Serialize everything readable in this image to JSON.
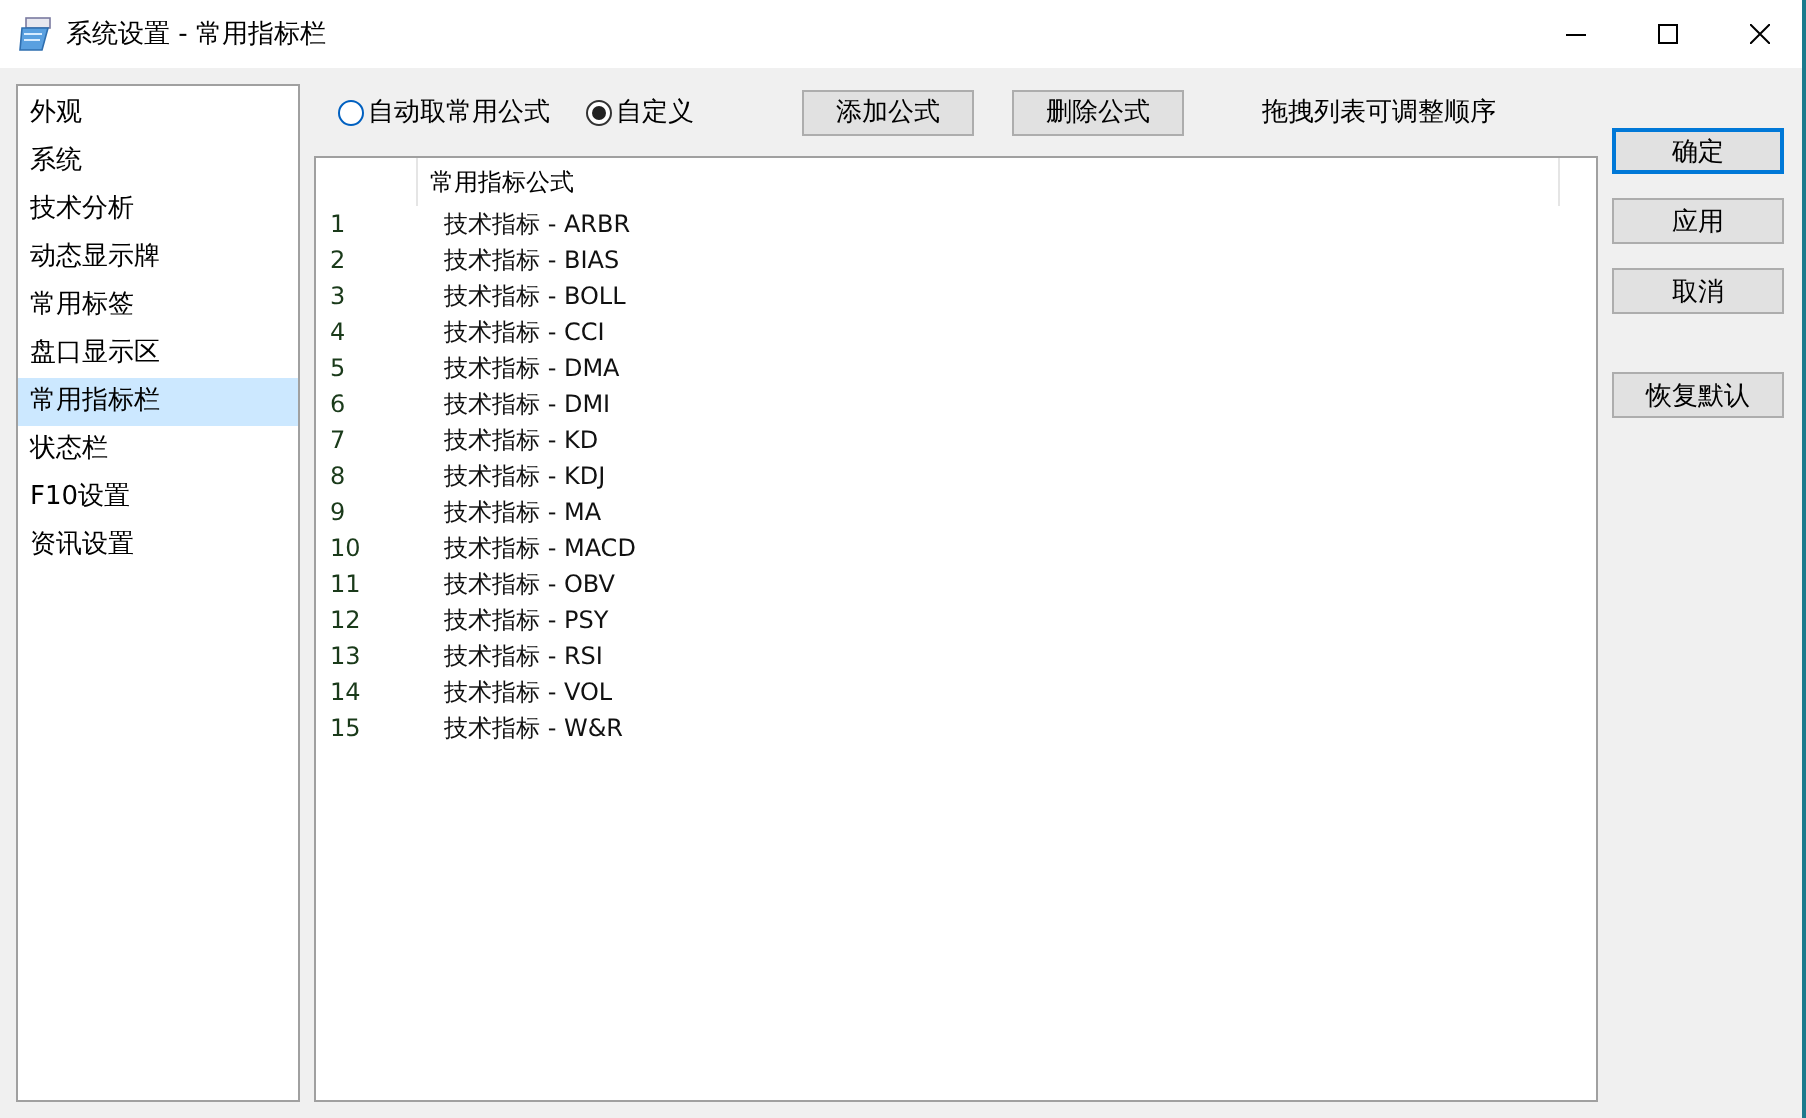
{
  "window": {
    "title": "系统设置 - 常用指标栏"
  },
  "sidebar": {
    "items": [
      {
        "label": "外观",
        "selected": false
      },
      {
        "label": "系统",
        "selected": false
      },
      {
        "label": "技术分析",
        "selected": false
      },
      {
        "label": "动态显示牌",
        "selected": false
      },
      {
        "label": "常用标签",
        "selected": false
      },
      {
        "label": "盘口显示区",
        "selected": false
      },
      {
        "label": "常用指标栏",
        "selected": true
      },
      {
        "label": "状态栏",
        "selected": false
      },
      {
        "label": "F10设置",
        "selected": false
      },
      {
        "label": "资讯设置",
        "selected": false
      }
    ]
  },
  "mode_options": [
    {
      "label": "自动取常用公式",
      "selected": false
    },
    {
      "label": "自定义",
      "selected": true
    }
  ],
  "toolbar_buttons": [
    "添加公式",
    "删除公式"
  ],
  "hint": "拖拽列表可调整顺序",
  "table": {
    "columns": [
      "常用指标公式"
    ],
    "rows": [
      {
        "index": "1",
        "formula": "技术指标 - ARBR"
      },
      {
        "index": "2",
        "formula": "技术指标 - BIAS"
      },
      {
        "index": "3",
        "formula": "技术指标 - BOLL"
      },
      {
        "index": "4",
        "formula": "技术指标 - CCI"
      },
      {
        "index": "5",
        "formula": "技术指标 - DMA"
      },
      {
        "index": "6",
        "formula": "技术指标 - DMI"
      },
      {
        "index": "7",
        "formula": "技术指标 - KD"
      },
      {
        "index": "8",
        "formula": "技术指标 - KDJ"
      },
      {
        "index": "9",
        "formula": "技术指标 - MA"
      },
      {
        "index": "10",
        "formula": "技术指标 - MACD"
      },
      {
        "index": "11",
        "formula": "技术指标 - OBV"
      },
      {
        "index": "12",
        "formula": "技术指标 - PSY"
      },
      {
        "index": "13",
        "formula": "技术指标 - RSI"
      },
      {
        "index": "14",
        "formula": "技术指标 - VOL"
      },
      {
        "index": "15",
        "formula": "技术指标 - W&R"
      }
    ]
  },
  "dialog_buttons": [
    {
      "label": "确定",
      "default": true
    },
    {
      "label": "应用",
      "default": false
    },
    {
      "label": "取消",
      "default": false
    }
  ],
  "reset_button": "恢复默认"
}
